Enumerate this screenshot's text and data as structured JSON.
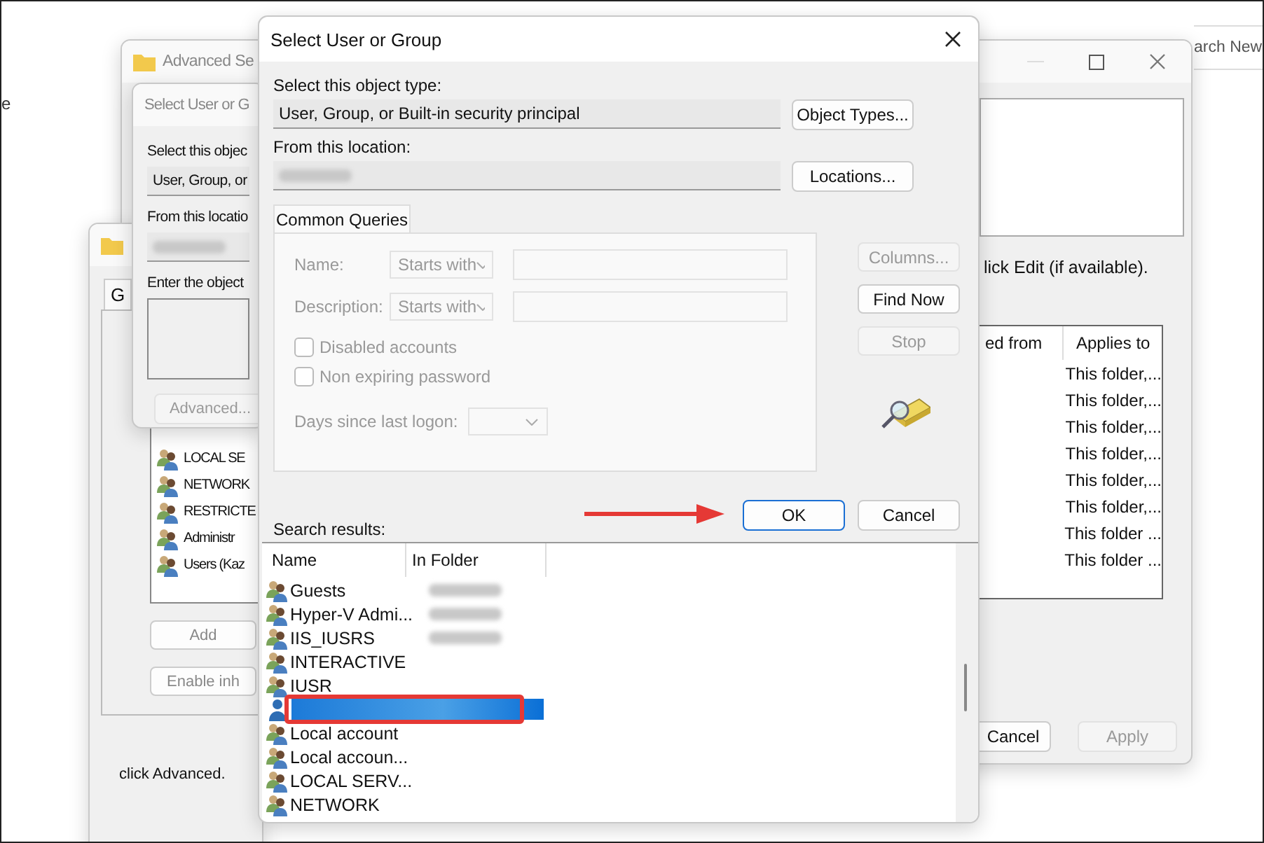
{
  "explorer": {
    "sidebar_items": [
      {
        "label": "e"
      }
    ],
    "search": {
      "placeholder": "arch New"
    }
  },
  "advanced_window": {
    "title": "Advanced Se",
    "hint": "lick Edit (if available).",
    "columns": [
      "ed from",
      "Applies to"
    ],
    "rows": [
      {
        "applies_to": "This folder,..."
      },
      {
        "applies_to": "This folder,..."
      },
      {
        "applies_to": "This folder,..."
      },
      {
        "applies_to": "This folder,..."
      },
      {
        "applies_to": "This folder,..."
      },
      {
        "applies_to": "This folder,..."
      },
      {
        "applies_to": "This folder ..."
      },
      {
        "applies_to": "This folder ..."
      }
    ],
    "buttons": [
      {
        "label": "Cancel",
        "disabled": false
      },
      {
        "label": "Apply",
        "disabled": true
      }
    ]
  },
  "permissions_window": {
    "tab": "G",
    "principals": [
      "LOCAL SE",
      "NETWORK",
      "RESTRICTE",
      "Administr",
      "Users (Kaz"
    ],
    "buttons": [
      "Add",
      "Enable inh"
    ],
    "footer": "click Advanced."
  },
  "second_dialog": {
    "title": "Select User or G",
    "object_type_label": "Select this objec",
    "object_type": "User, Group, or",
    "location_label": "From this locatio",
    "object_names_label": "Enter the object",
    "advanced_button": "Advanced..."
  },
  "dialog": {
    "title": "Select User or Group",
    "object_type_label": "Select this object type:",
    "object_type": "User, Group, or Built-in security principal",
    "object_types_button": "Object Types...",
    "location_label": "From this location:",
    "locations_button": "Locations...",
    "tab": {
      "label": "Common Queries",
      "selected": true
    },
    "query_fields": [
      {
        "label": "Name:",
        "operator": "Starts with",
        "disabled": true
      },
      {
        "label": "Description:",
        "operator": "Starts with",
        "disabled": true
      }
    ],
    "checkboxes": [
      {
        "label": "Disabled accounts",
        "checked": false,
        "disabled": true
      },
      {
        "label": "Non expiring password",
        "checked": false,
        "disabled": true
      }
    ],
    "days_label": "Days since last logon:",
    "side_buttons": [
      {
        "label": "Columns...",
        "disabled": true
      },
      {
        "label": "Find Now",
        "disabled": false
      },
      {
        "label": "Stop",
        "disabled": true
      }
    ],
    "ok_button": "OK",
    "cancel_button": "Cancel",
    "results_label": "Search results:",
    "columns": [
      "Name",
      "In Folder"
    ],
    "rows": [
      {
        "kind": "group",
        "name": "Guests",
        "folder_blurred": true,
        "selected": false,
        "highlighted": false
      },
      {
        "kind": "group",
        "name": "Hyper-V Admi...",
        "folder_blurred": true,
        "selected": false,
        "highlighted": false
      },
      {
        "kind": "group",
        "name": "IIS_IUSRS",
        "folder_blurred": true,
        "selected": false,
        "highlighted": false
      },
      {
        "kind": "group",
        "name": "INTERACTIVE",
        "folder_blurred": false,
        "selected": false,
        "highlighted": false
      },
      {
        "kind": "group",
        "name": "IUSR",
        "folder_blurred": false,
        "selected": false,
        "highlighted": false
      },
      {
        "kind": "user",
        "folder_blurred": false,
        "selected": true,
        "highlighted": true
      },
      {
        "kind": "group",
        "name": "Local account",
        "folder_blurred": false,
        "selected": false,
        "highlighted": false
      },
      {
        "kind": "group",
        "name": "Local accoun...",
        "folder_blurred": false,
        "selected": false,
        "highlighted": false
      },
      {
        "kind": "group",
        "name": "LOCAL SERV...",
        "folder_blurred": false,
        "selected": false,
        "highlighted": false
      },
      {
        "kind": "group",
        "name": "NETWORK",
        "folder_blurred": false,
        "selected": false,
        "highlighted": false
      }
    ]
  }
}
